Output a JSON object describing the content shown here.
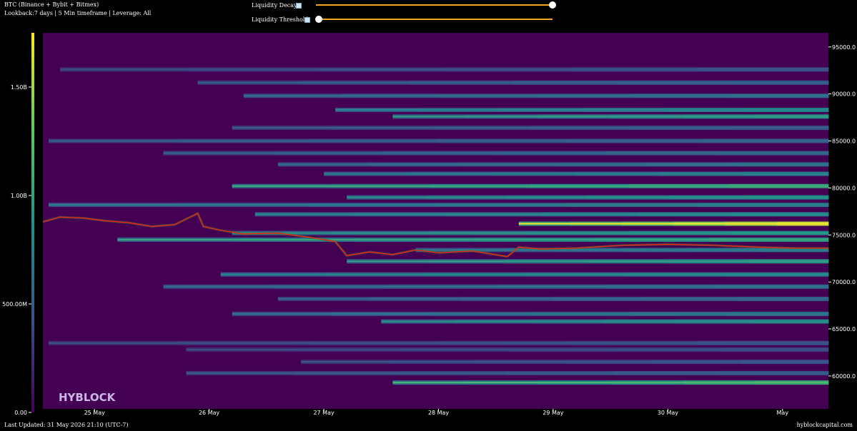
{
  "header": {
    "title": "BTC (Binance + Bybit + Bitmex)",
    "subtitle": "Lookback:7 days | 5 Min timeframe | Leverage: All"
  },
  "controls": {
    "liquidity_decay": {
      "label": "Liquidity Decay",
      "value": 1.0
    },
    "liquidity_threshold": {
      "label": "Liquidity Threshold",
      "value": 0.0
    }
  },
  "footer": {
    "last_updated": "Last Updated: 31 May 2026 21:10 (UTC-7)",
    "source": "hyblockcapital.com"
  },
  "logo_text": "HYBLOCK",
  "colors": {
    "background": "#440154",
    "price_line": "#ff1a1a",
    "slider_track": "#f5a623",
    "colormap": [
      "#440154",
      "#3b528b",
      "#21918c",
      "#5ec962",
      "#fde725"
    ]
  },
  "chart_data": {
    "type": "heatmap",
    "title": "",
    "x_ticks": [
      "25 May",
      "26 May",
      "27 May",
      "28 May",
      "29 May",
      "30 May",
      "May"
    ],
    "x_range": [
      24.55,
      31.4
    ],
    "y_ticks": [
      60000,
      65000,
      70000,
      75000,
      80000,
      85000,
      90000,
      95000
    ],
    "y_tick_labels": [
      "60000.0",
      "65000.0",
      "70000.0",
      "75000.0",
      "80000.0",
      "85000.0",
      "90000.0",
      "95000.0"
    ],
    "y_range": [
      56500,
      96500
    ],
    "colorbar": {
      "ticks": [
        0,
        500000000,
        1000000000,
        1500000000
      ],
      "tick_labels": [
        "0.00",
        "500.00M",
        "1.00B",
        "1.50B"
      ],
      "range": [
        0,
        1750000000
      ]
    },
    "liquidity_levels": [
      {
        "price": 59300,
        "start": 27.6,
        "intensity": 0.62
      },
      {
        "price": 60300,
        "start": 25.8,
        "intensity": 0.28
      },
      {
        "price": 61500,
        "start": 26.8,
        "intensity": 0.25
      },
      {
        "price": 62800,
        "start": 25.8,
        "intensity": 0.22
      },
      {
        "price": 63500,
        "start": 24.6,
        "intensity": 0.24
      },
      {
        "price": 65800,
        "start": 27.5,
        "intensity": 0.48
      },
      {
        "price": 66600,
        "start": 26.2,
        "intensity": 0.38
      },
      {
        "price": 68200,
        "start": 26.6,
        "intensity": 0.32
      },
      {
        "price": 69500,
        "start": 25.6,
        "intensity": 0.36
      },
      {
        "price": 70800,
        "start": 26.1,
        "intensity": 0.45
      },
      {
        "price": 72200,
        "start": 27.2,
        "intensity": 0.52
      },
      {
        "price": 73400,
        "start": 27.8,
        "intensity": 0.4
      },
      {
        "price": 74500,
        "start": 25.2,
        "intensity": 0.55
      },
      {
        "price": 75200,
        "start": 26.2,
        "intensity": 0.5
      },
      {
        "price": 76200,
        "start": 28.7,
        "intensity": 0.92
      },
      {
        "price": 77200,
        "start": 26.4,
        "intensity": 0.46
      },
      {
        "price": 78200,
        "start": 24.6,
        "intensity": 0.4
      },
      {
        "price": 79000,
        "start": 27.2,
        "intensity": 0.48
      },
      {
        "price": 80200,
        "start": 26.2,
        "intensity": 0.58
      },
      {
        "price": 81500,
        "start": 27.0,
        "intensity": 0.42
      },
      {
        "price": 82500,
        "start": 26.6,
        "intensity": 0.36
      },
      {
        "price": 83700,
        "start": 25.6,
        "intensity": 0.32
      },
      {
        "price": 85000,
        "start": 24.6,
        "intensity": 0.3
      },
      {
        "price": 86400,
        "start": 26.2,
        "intensity": 0.28
      },
      {
        "price": 87600,
        "start": 27.6,
        "intensity": 0.52
      },
      {
        "price": 88300,
        "start": 27.1,
        "intensity": 0.44
      },
      {
        "price": 89800,
        "start": 26.3,
        "intensity": 0.36
      },
      {
        "price": 91200,
        "start": 25.9,
        "intensity": 0.3
      },
      {
        "price": 92600,
        "start": 24.7,
        "intensity": 0.24
      }
    ],
    "price_series": {
      "name": "",
      "x": [
        24.55,
        24.7,
        24.9,
        25.1,
        25.3,
        25.5,
        25.7,
        25.9,
        25.95,
        26.1,
        26.3,
        26.6,
        26.9,
        27.1,
        27.2,
        27.4,
        27.6,
        27.8,
        28.0,
        28.3,
        28.6,
        28.7,
        28.9,
        29.2,
        29.6,
        30.0,
        30.4,
        30.8,
        31.1,
        31.4
      ],
      "y": [
        76400,
        76900,
        76800,
        76500,
        76300,
        75900,
        76100,
        77300,
        75900,
        75500,
        75100,
        75200,
        74700,
        74300,
        72800,
        73200,
        72900,
        73400,
        73100,
        73300,
        72700,
        73700,
        73500,
        73600,
        73900,
        74000,
        73900,
        73700,
        73600,
        73600
      ]
    }
  }
}
